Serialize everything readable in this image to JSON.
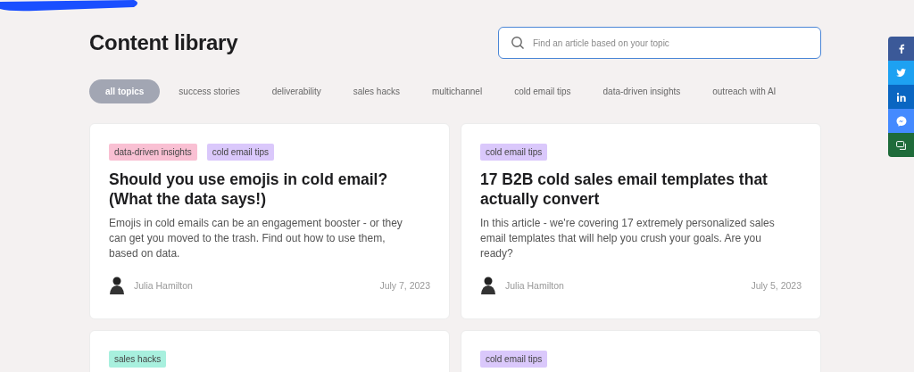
{
  "header": {
    "title": "Content library"
  },
  "search": {
    "placeholder": "Find an article based on your topic"
  },
  "topics": [
    {
      "label": "all topics",
      "selected": true
    },
    {
      "label": "success stories",
      "selected": false
    },
    {
      "label": "deliverability",
      "selected": false
    },
    {
      "label": "sales hacks",
      "selected": false
    },
    {
      "label": "multichannel",
      "selected": false
    },
    {
      "label": "cold email tips",
      "selected": false
    },
    {
      "label": "data-driven insights",
      "selected": false
    },
    {
      "label": "outreach with AI",
      "selected": false
    }
  ],
  "articles": [
    {
      "tags": [
        {
          "label": "data-driven insights",
          "color": "#f9c0d3"
        },
        {
          "label": "cold email tips",
          "color": "#dac8fb"
        }
      ],
      "title": "Should you use emojis in cold email? (What the data says!)",
      "excerpt": "Emojis in cold emails can be an engagement booster - or they can get you moved to the trash. Find out how to use them, based on data.",
      "author": "Julia Hamilton",
      "date": "July 7, 2023"
    },
    {
      "tags": [
        {
          "label": "cold email tips",
          "color": "#dac8fb"
        }
      ],
      "title": "17 B2B cold sales email templates that actually convert",
      "excerpt": "In this article - we're covering 17 extremely personalized sales email templates that will help you crush your goals. Are you ready?",
      "author": "Julia Hamilton",
      "date": "July 5, 2023"
    },
    {
      "tags": [
        {
          "label": "sales hacks",
          "color": "#a8f0de"
        }
      ]
    },
    {
      "tags": [
        {
          "label": "cold email tips",
          "color": "#dac8fb"
        }
      ]
    }
  ],
  "share": [
    {
      "kind": "facebook",
      "color": "#3b5998"
    },
    {
      "kind": "twitter",
      "color": "#1da1f2"
    },
    {
      "kind": "linkedin",
      "color": "#0a66c2"
    },
    {
      "kind": "messenger",
      "color": "#448aff"
    },
    {
      "kind": "sms",
      "color": "#1e6b3a"
    }
  ]
}
